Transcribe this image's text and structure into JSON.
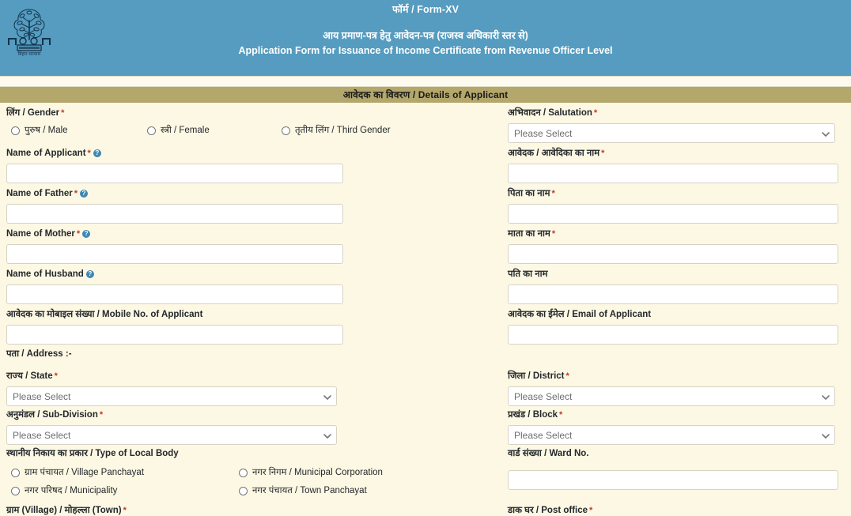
{
  "header": {
    "emblem_alt": "Government of Bihar Emblem",
    "emblem_caption": "बिहार सरकार",
    "form_no": "फॉर्म / Form-XV",
    "title_hi": "आय प्रमाण-पत्र हेतु आवेदन-पत्र (राजस्व अधिकारी स्तर से)",
    "title_en": "Application Form for Issuance of Income Certificate from Revenue Officer Level",
    "band_color": "#559cc0"
  },
  "section": {
    "title": "आवेदक का विवरण / Details of Applicant",
    "bar_color": "#b3a76b"
  },
  "common": {
    "please_select": "Please Select",
    "required_mark": "*",
    "help_glyph": "?"
  },
  "fields": {
    "gender": {
      "label": "लिंग / Gender",
      "options": [
        {
          "label": "पुरुष / Male",
          "value": "male"
        },
        {
          "label": "स्त्री / Female",
          "value": "female"
        },
        {
          "label": "तृतीय लिंग / Third Gender",
          "value": "third"
        }
      ]
    },
    "salutation": {
      "label": "अभिवादन / Salutation",
      "value": "Please Select"
    },
    "name_of_applicant": {
      "label": "Name of Applicant",
      "value": ""
    },
    "applicant_name_hi": {
      "label": "आवेदक / आवेदिका का नाम",
      "value": ""
    },
    "name_of_father": {
      "label": "Name of Father",
      "value": ""
    },
    "father_name_hi": {
      "label": "पिता का नाम",
      "value": ""
    },
    "name_of_mother": {
      "label": "Name of Mother",
      "value": ""
    },
    "mother_name_hi": {
      "label": "माता का नाम",
      "value": ""
    },
    "name_of_husband": {
      "label": "Name of Husband",
      "value": ""
    },
    "husband_name_hi": {
      "label": "पति का नाम",
      "value": ""
    },
    "mobile": {
      "label": "आवेदक का मोबाइल संख्या / Mobile No. of Applicant",
      "value": ""
    },
    "email": {
      "label": "आवेदक का ईमेल / Email of Applicant",
      "value": ""
    },
    "address_heading": {
      "label": "पता / Address :-"
    },
    "state": {
      "label": "राज्य / State",
      "value": "Please Select"
    },
    "district": {
      "label": "जिला / District",
      "value": "Please Select"
    },
    "sub_division": {
      "label": "अनुमंडल / Sub-Division",
      "value": "Please Select"
    },
    "block": {
      "label": "प्रखंड / Block",
      "value": "Please Select"
    },
    "local_body": {
      "label": "स्थानीय निकाय का प्रकार / Type of Local Body",
      "options": [
        {
          "label": "ग्राम पंचायत / Village Panchayat",
          "value": "village-panchayat"
        },
        {
          "label": "नगर निगम / Municipal Corporation",
          "value": "municipal-corporation"
        },
        {
          "label": "नगर परिषद / Municipality",
          "value": "municipality"
        },
        {
          "label": "नगर पंचायत / Town Panchayat",
          "value": "town-panchayat"
        }
      ]
    },
    "ward_no": {
      "label": "वार्ड संख्या / Ward No.",
      "value": ""
    },
    "village_town": {
      "label": "ग्राम (Village) / मोहल्ला (Town)"
    },
    "post_office": {
      "label": "डाक घर / Post office"
    }
  },
  "colors": {
    "page_bg": "#fdf8e3",
    "header_blue": "#559cc0",
    "section_khaki": "#b3a76b",
    "required_red": "#c0392b",
    "help_blue": "#3f87b5",
    "input_border": "#d6d3c4"
  }
}
